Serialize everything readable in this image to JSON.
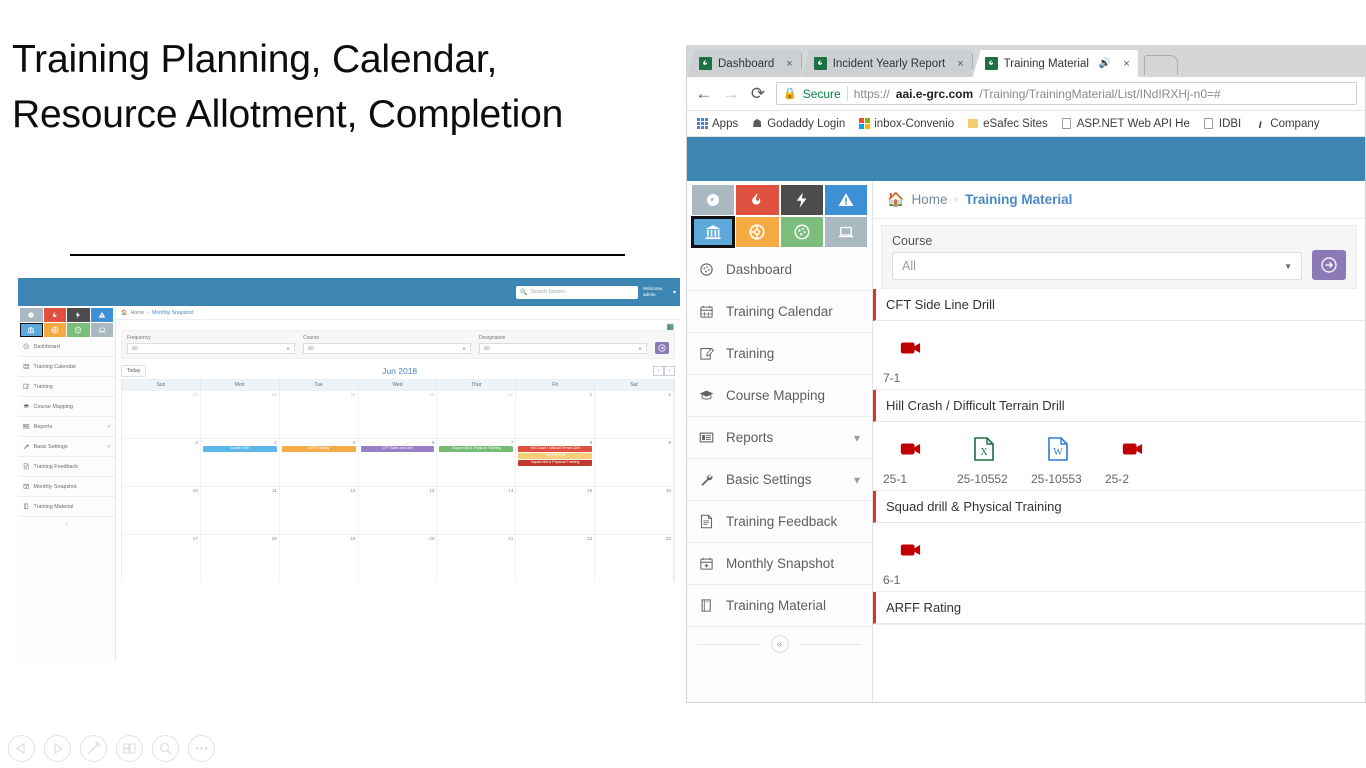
{
  "slide": {
    "title": "Training Planning, Calendar, Resource Allotment, Completion",
    "toolbar": [
      {
        "name": "previous-slide-button",
        "icon": "triangle-left-icon"
      },
      {
        "name": "next-slide-button",
        "icon": "triangle-right-icon"
      },
      {
        "name": "pen-tool-button",
        "icon": "pen-icon"
      },
      {
        "name": "slide-grid-button",
        "icon": "grid-icon"
      },
      {
        "name": "zoom-button",
        "icon": "magnifier-icon"
      },
      {
        "name": "more-options-button",
        "icon": "ellipsis-icon"
      }
    ]
  },
  "browser": {
    "tabs": [
      {
        "title": "Dashboard",
        "active": false,
        "close": "×",
        "muted": false
      },
      {
        "title": "Incident Yearly Report",
        "active": false,
        "close": "×",
        "muted": false
      },
      {
        "title": "Training Material",
        "active": true,
        "close": "×",
        "muted": true
      }
    ],
    "new_tab_label": "",
    "nav": {
      "back": "←",
      "forward": "→",
      "reload": "⟳"
    },
    "omnibox": {
      "security_label": "Secure",
      "url_scheme": "https://",
      "url_host": "aai.e-grc.com",
      "url_path": "/Training/TrainingMaterial/List/INdIRXHj-n0=#"
    },
    "bookmarks": [
      {
        "label": "Apps",
        "icon": "apps-grid-icon"
      },
      {
        "label": "Godaddy Login",
        "icon": "godaddy-icon"
      },
      {
        "label": "inbox-Convenio",
        "icon": "microsoft-icon"
      },
      {
        "label": "eSafec Sites",
        "icon": "folder-icon"
      },
      {
        "label": "ASP.NET Web API He",
        "icon": "page-icon"
      },
      {
        "label": "IDBI",
        "icon": "page-icon"
      },
      {
        "label": "Company",
        "icon": "italic-i-icon"
      }
    ]
  },
  "app": {
    "module_tiles": [
      {
        "name": "compass-tile",
        "icon": "◉",
        "bg": "#aab9c1",
        "selected": false
      },
      {
        "name": "fire-tile",
        "icon": "♨",
        "bg": "#e0503f",
        "selected": false
      },
      {
        "name": "bolt-tile",
        "icon": "⚡",
        "bg": "#4c4c4c",
        "selected": false
      },
      {
        "name": "warning-tile",
        "icon": "⚠",
        "bg": "#3d90d4",
        "selected": false
      },
      {
        "name": "training-tile",
        "icon": "Ἵb",
        "bg": "#5fa8dc",
        "selected": true
      },
      {
        "name": "lifebuoy-tile",
        "icon": "❁",
        "bg": "#f5a942",
        "selected": false
      },
      {
        "name": "gauge-tile",
        "icon": "◔",
        "bg": "#7bbd7b",
        "selected": false
      },
      {
        "name": "laptop-tile",
        "icon": "▭",
        "bg": "#aab9c1",
        "selected": false
      }
    ],
    "sidebar": [
      {
        "label": "Dashboard",
        "icon": "dashboard-icon",
        "expandable": false
      },
      {
        "label": "Training Calendar",
        "icon": "calendar-icon",
        "expandable": false
      },
      {
        "label": "Training",
        "icon": "edit-icon",
        "expandable": false
      },
      {
        "label": "Course Mapping",
        "icon": "graduation-cap-icon",
        "expandable": false
      },
      {
        "label": "Reports",
        "icon": "report-icon",
        "expandable": true
      },
      {
        "label": "Basic Settings",
        "icon": "wrench-icon",
        "expandable": true
      },
      {
        "label": "Training Feedback",
        "icon": "document-icon",
        "expandable": false
      },
      {
        "label": "Monthly Snapshot",
        "icon": "calendar-plus-icon",
        "expandable": false
      },
      {
        "label": "Training Material",
        "icon": "book-icon",
        "expandable": false
      }
    ],
    "collapse_label": "«",
    "breadcrumb": {
      "home": "Home",
      "separator": "›",
      "current": "Training Material"
    },
    "filter": {
      "label": "Course",
      "value": "All",
      "go_icon": "arrow-right-circle-icon"
    },
    "sections": [
      {
        "title": "CFT Side Line Drill",
        "files": [
          {
            "label": "7-1",
            "type": "video"
          }
        ]
      },
      {
        "title": "Hill Crash / Difficult Terrain Drill",
        "files": [
          {
            "label": "25-1",
            "type": "video"
          },
          {
            "label": "25-10552",
            "type": "excel"
          },
          {
            "label": "25-10553",
            "type": "word"
          },
          {
            "label": "25-2",
            "type": "video"
          }
        ]
      },
      {
        "title": "Squad drill & Physical Training",
        "files": [
          {
            "label": "6-1",
            "type": "video"
          }
        ]
      },
      {
        "title": "ARFF Rating",
        "files": []
      }
    ]
  },
  "mini": {
    "search_placeholder": "Search Screen",
    "welcome": "Welcome, admin",
    "module_tiles": [
      {
        "name": "compass-tile",
        "bg": "#aab9c1",
        "selected": false
      },
      {
        "name": "fire-tile",
        "bg": "#e0503f",
        "selected": false
      },
      {
        "name": "bolt-tile",
        "bg": "#4c4c4c",
        "selected": false
      },
      {
        "name": "warning-tile",
        "bg": "#3d90d4",
        "selected": false
      },
      {
        "name": "training-tile",
        "bg": "#5fa8dc",
        "selected": true
      },
      {
        "name": "lifebuoy-tile",
        "bg": "#f5a942",
        "selected": false
      },
      {
        "name": "gauge-tile",
        "bg": "#7bbd7b",
        "selected": false
      },
      {
        "name": "laptop-tile",
        "bg": "#aab9c1",
        "selected": false
      }
    ],
    "sidebar": [
      {
        "label": "Dashboard",
        "expandable": false
      },
      {
        "label": "Training Calendar",
        "expandable": false
      },
      {
        "label": "Training",
        "expandable": false
      },
      {
        "label": "Course Mapping",
        "expandable": false
      },
      {
        "label": "Reports",
        "expandable": true
      },
      {
        "label": "Basic Settings",
        "expandable": true
      },
      {
        "label": "Training Feedback",
        "expandable": false
      },
      {
        "label": "Monthly Snapshot",
        "expandable": false
      },
      {
        "label": "Training Material",
        "expandable": false
      }
    ],
    "collapse_label": "«",
    "breadcrumb": {
      "home": "Home",
      "separator": "›",
      "current": "Monthly Snapshot"
    },
    "filters": [
      {
        "label": "Frequency",
        "value": "All"
      },
      {
        "label": "Course",
        "value": "All"
      },
      {
        "label": "Designation",
        "value": "All"
      }
    ],
    "go_icon": "arrow-right-circle-icon",
    "export_icon": "excel-export-icon",
    "calendar": {
      "today_label": "Today",
      "month_label": "Jun 2018",
      "prev": "‹",
      "next": "›",
      "dow": [
        "Sun",
        "Mon",
        "Tue",
        "Wed",
        "Thur",
        "Fri",
        "Sat"
      ],
      "weeks": [
        [
          {
            "day": "27",
            "dim": true,
            "events": []
          },
          {
            "day": "28",
            "dim": true,
            "events": []
          },
          {
            "day": "29",
            "dim": true,
            "events": []
          },
          {
            "day": "30",
            "dim": true,
            "events": []
          },
          {
            "day": "31",
            "dim": true,
            "events": []
          },
          {
            "day": "1",
            "dim": false,
            "events": []
          },
          {
            "day": "2",
            "dim": false,
            "events": []
          }
        ],
        [
          {
            "day": "3",
            "dim": false,
            "events": []
          },
          {
            "day": "4",
            "dim": false,
            "events": [
              {
                "label": "Ladder Drill",
                "color": "#5bb8e8"
              }
            ]
          },
          {
            "day": "5",
            "dim": false,
            "events": [
              {
                "label": "ARFF Rating",
                "color": "#f5ab48"
              }
            ]
          },
          {
            "day": "6",
            "dim": false,
            "events": [
              {
                "label": "CFT Side Line Drill",
                "color": "#9b7fc4"
              }
            ]
          },
          {
            "day": "7",
            "dim": false,
            "events": [
              {
                "label": "Squad drill & Physical Training",
                "color": "#73bd73"
              }
            ]
          },
          {
            "day": "8",
            "dim": false,
            "events": [
              {
                "label": "Hill Crash / Difficult Terrain Drill",
                "color": "#e0503f"
              },
              {
                "label": "Hot Fire Drill",
                "color": "#f5cf78"
              },
              {
                "label": "Squad drill & Physical Training",
                "color": "#c0392b"
              }
            ]
          },
          {
            "day": "9",
            "dim": false,
            "events": []
          }
        ],
        [
          {
            "day": "10",
            "dim": false,
            "events": []
          },
          {
            "day": "11",
            "dim": false,
            "events": []
          },
          {
            "day": "12",
            "dim": false,
            "events": []
          },
          {
            "day": "13",
            "dim": false,
            "events": []
          },
          {
            "day": "14",
            "dim": false,
            "events": []
          },
          {
            "day": "15",
            "dim": false,
            "events": []
          },
          {
            "day": "16",
            "dim": false,
            "events": []
          }
        ],
        [
          {
            "day": "17",
            "dim": false,
            "events": []
          },
          {
            "day": "18",
            "dim": false,
            "events": []
          },
          {
            "day": "19",
            "dim": false,
            "events": []
          },
          {
            "day": "20",
            "dim": false,
            "events": []
          },
          {
            "day": "21",
            "dim": false,
            "events": []
          },
          {
            "day": "22",
            "dim": false,
            "events": []
          },
          {
            "day": "23",
            "dim": false,
            "events": []
          }
        ]
      ]
    }
  }
}
